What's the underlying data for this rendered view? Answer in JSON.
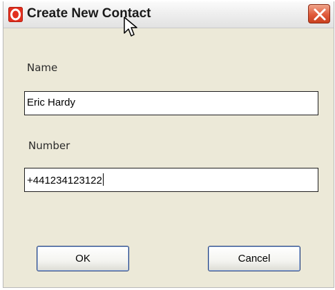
{
  "window": {
    "title": "Create New Contact"
  },
  "form": {
    "name_label": "Name",
    "name_value": "Eric Hardy",
    "number_label": "Number",
    "number_value": "+441234123122"
  },
  "buttons": {
    "ok_label": "OK",
    "cancel_label": "Cancel"
  },
  "icons": {
    "app": "opera-logo-icon",
    "close": "close-icon",
    "pointer": "mouse-cursor-icon"
  },
  "colors": {
    "app_icon": "#e2301f",
    "close_button": "#e05a3a",
    "dialog_background": "#ece9d8"
  }
}
